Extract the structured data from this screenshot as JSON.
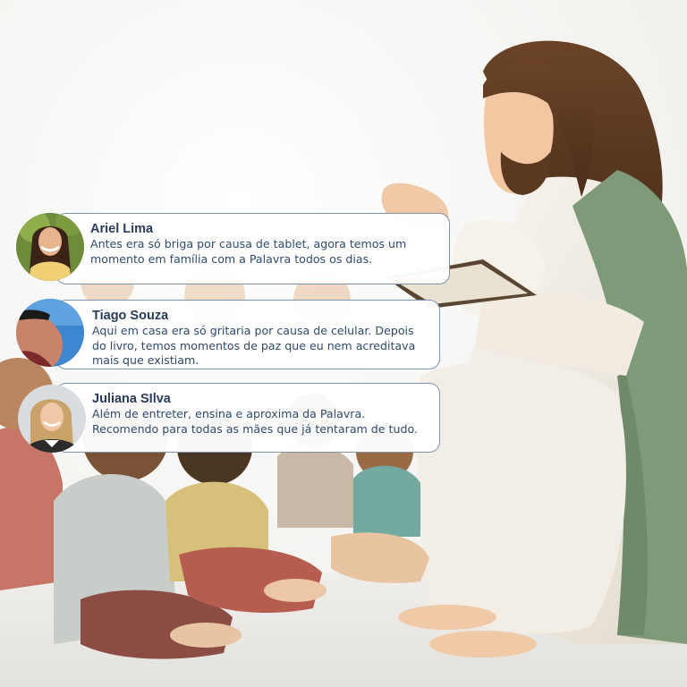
{
  "testimonials": [
    {
      "name": "Ariel Lima",
      "text": "Antes era só briga por causa de tablet, agora temos um momento em família com a Palavra todos os dias.",
      "avatar_icon": "woman-portrait-photo"
    },
    {
      "name": "Tiago Souza",
      "text": "Aqui em casa era só gritaria por causa de celular. Depois do livro, temos momentos de paz que eu nem acreditava mais que existiam.",
      "avatar_icon": "man-sunglasses-sky-photo"
    },
    {
      "name": "Juliana SIlva",
      "text": "Além de entreter, ensina e aproxima da Palavra. Recomendo para todas as mães que já tentaram de tudo.",
      "avatar_icon": "woman-blonde-portrait-photo"
    }
  ],
  "colors": {
    "card_border": "#7f93ad",
    "name_text": "#2a3b57",
    "body_text": "#2f4a6b",
    "robe": "#efe9de",
    "sash": "#7f9a78"
  }
}
